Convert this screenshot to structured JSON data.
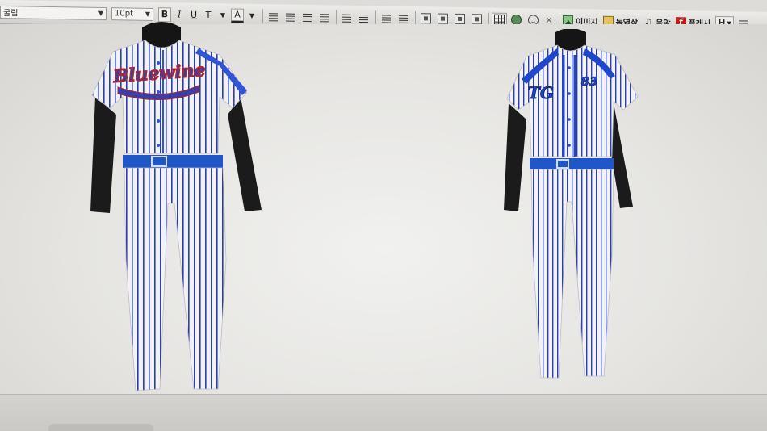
{
  "toolbar": {
    "font_select": "굴림",
    "size_select": "10pt",
    "bold": "B",
    "italic": "I",
    "underline": "U",
    "strike": "T",
    "color": "A",
    "image_label": "이미지",
    "video_label": "동영상",
    "music_label": "음악",
    "flash_label": "플래시",
    "heading_select": "H"
  },
  "canvas": {
    "left_uniform": {
      "script_text": "Bluewine",
      "colors": {
        "stripe": "#2a3fae",
        "base": "#f2f2f4",
        "accent": "#2f55d6",
        "script_fill": "#3a3fa6",
        "script_outline": "#b0262a",
        "sleeve": "#1b1b1b",
        "belt": "#1f56c8"
      }
    },
    "right_uniform": {
      "logo_text": "TG",
      "number_text": "83",
      "colors": {
        "stripe": "#2a3fae",
        "base": "#f2f2f4",
        "accent": "#1f47c9",
        "sleeve": "#1b1b1b",
        "belt": "#1f56c8"
      }
    }
  }
}
